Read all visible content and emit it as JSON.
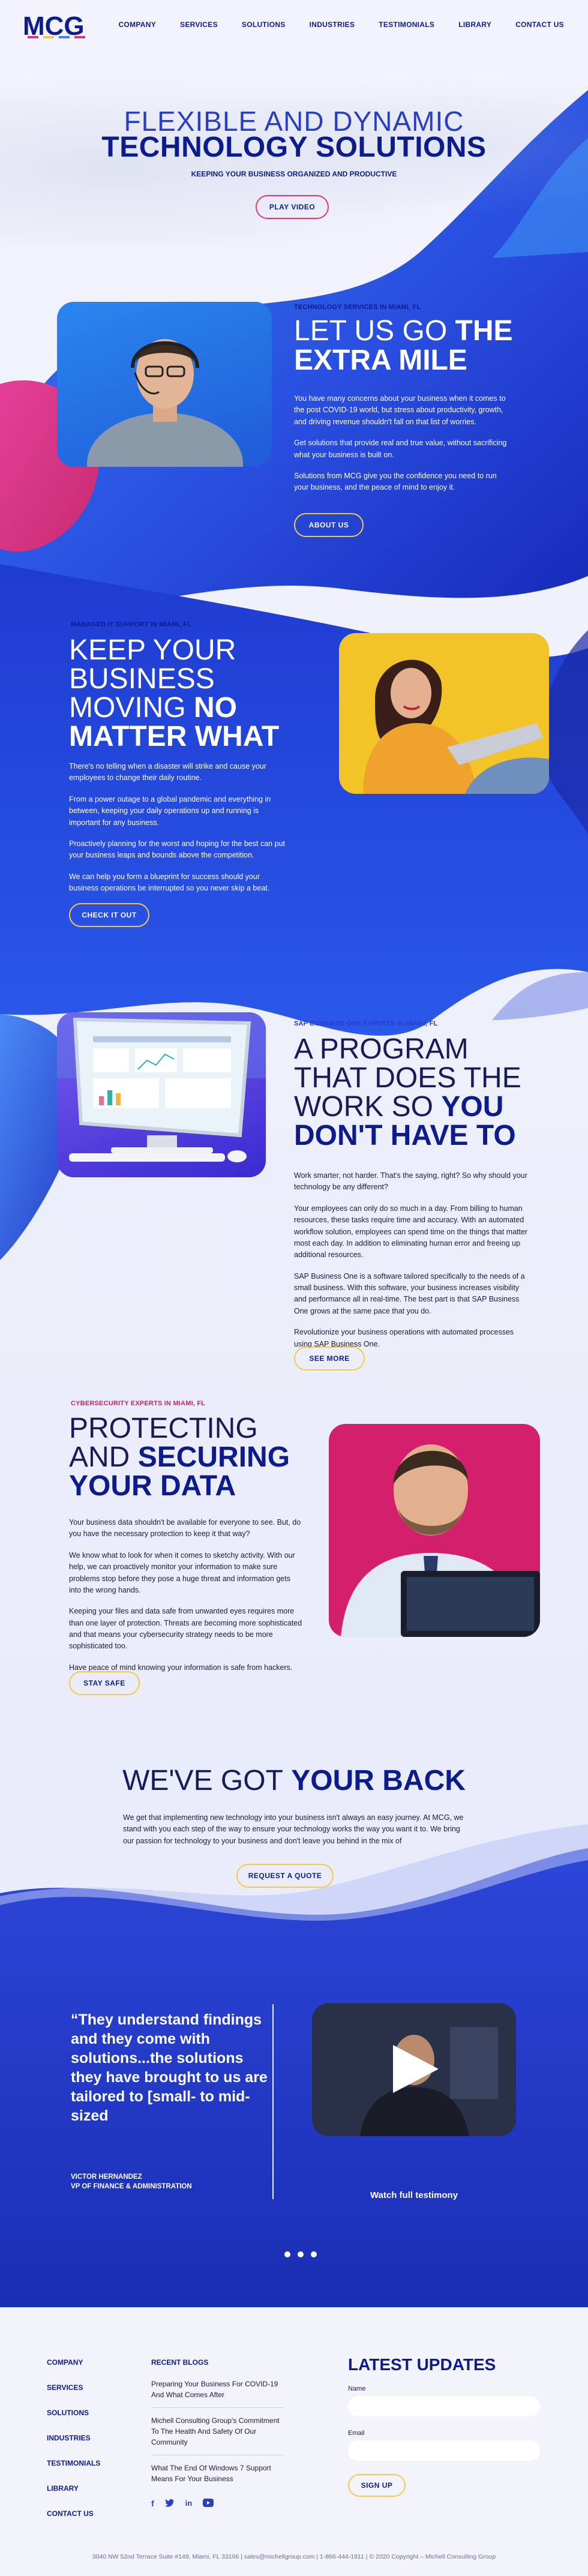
{
  "colors": {
    "navy": "#0d1c8c",
    "blue": "#2a3ec0",
    "pink": "#e0347c",
    "yellow": "#f5c94a",
    "background": "#eef0fb"
  },
  "brand": {
    "logo_text": "MCG"
  },
  "nav": {
    "items": [
      "COMPANY",
      "SERVICES",
      "SOLUTIONS",
      "INDUSTRIES",
      "TESTIMONIALS",
      "LIBRARY",
      "CONTACT US"
    ]
  },
  "hero": {
    "title_light": "FLEXIBLE AND DYNAMIC",
    "title_bold": "TECHNOLOGY SOLUTIONS",
    "subtitle": "KEEPING YOUR BUSINESS ORGANIZED AND PRODUCTIVE",
    "button": "PLAY VIDEO"
  },
  "section1": {
    "eyebrow": "TECHNOLOGY SERVICES IN MIAMI, FL",
    "heading_light": "LET US GO",
    "heading_bold_inline": "THE",
    "heading_bold": "EXTRA MILE",
    "paragraphs": [
      "You have many concerns about your business when it comes to the post COVID-19 world, but stress about productivity, growth, and driving revenue shouldn't fall on that list of worries.",
      "Get solutions that provide real and true value, without sacrificing what your business is built on.",
      "Solutions from MCG give you the confidence you need to run your business, and the peace of mind to enjoy it."
    ],
    "button": "ABOUT US"
  },
  "section2": {
    "eyebrow": "MANAGED IT SUPPORT IN MIAMI, FL",
    "heading_light_1": "KEEP YOUR",
    "heading_light_2": "BUSINESS",
    "heading_light_3": "MOVING",
    "heading_bold_inline": "NO",
    "heading_bold": "MATTER WHAT",
    "paragraphs": [
      "There's no telling when a disaster will strike and cause your employees to change their daily routine.",
      "From a power outage to a global pandemic and everything in between, keeping your daily operations up and running is important for any business.",
      "Proactively planning for the worst and hoping for the best can put your business leaps and bounds above the competition.",
      "We can help you form a blueprint for success should your business operations be interrupted so you never skip a beat."
    ],
    "button": "CHECK IT OUT"
  },
  "section3": {
    "eyebrow": "SAP BUSINESS ONE EXPERTS IN MIAMI, FL",
    "heading_light_1": "A PROGRAM",
    "heading_light_2": "THAT DOES THE",
    "heading_light_3": "WORK SO",
    "heading_bold_inline": "YOU",
    "heading_bold": "DON'T HAVE TO",
    "paragraphs": [
      "Work smarter, not harder. That's the saying, right? So why should your technology be any different?",
      "Your employees can only do so much in a day. From billing to human resources, these tasks require time and accuracy. With an automated workflow solution, employees can spend time on the things that matter most each day. In addition to eliminating human error and freeing up additional resources.",
      "SAP Business One is a software tailored specifically to the needs of a small business. With this software, your business increases visibility and performance all in real-time. The best part is that SAP Business One grows at the same pace that you do.",
      "Revolutionize your business operations with automated processes using SAP Business One."
    ],
    "button": "SEE MORE"
  },
  "section4": {
    "eyebrow": "CYBERSECURITY EXPERTS IN MIAMI, FL",
    "heading_light_1": "PROTECTING",
    "heading_light_2": "AND",
    "heading_bold_inline": "SECURING",
    "heading_bold": "YOUR DATA",
    "paragraphs": [
      "Your business data shouldn't be available for everyone to see. But, do you have the necessary protection to keep it that way?",
      "We know what to look for when it comes to sketchy activity. With our help, we can proactively monitor your information to make sure problems stop before they pose a huge threat and information gets into the wrong hands.",
      "Keeping your files and data safe from unwanted eyes requires more than one layer of protection. Threats are becoming more sophisticated and that means your cybersecurity strategy needs to be more sophisticated too.",
      "Have peace of mind knowing your information is safe from hackers."
    ],
    "button": "STAY SAFE"
  },
  "section5": {
    "heading_light": "WE'VE GOT",
    "heading_bold": "YOUR BACK",
    "paragraph": "We get that implementing new technology into your business isn't always an easy journey. At MCG, we stand with you each step of the way to ensure your technology works the way you want it to. We bring our passion for technology to your business and don't leave you behind in the mix of",
    "button": "REQUEST A QUOTE"
  },
  "testimonial": {
    "quote": "“They understand findings and they come with solutions...the solutions they have brought to us are tailored to [small- to mid-sized",
    "name": "VICTOR HERNANDEZ",
    "role": "VP OF FINANCE & ADMINISTRATION",
    "video_label": "Watch full testimony"
  },
  "footer": {
    "links": [
      "COMPANY",
      "SERVICES",
      "SOLUTIONS",
      "INDUSTRIES",
      "TESTIMONIALS",
      "LIBRARY",
      "CONTACT US"
    ],
    "blogs_title": "RECENT BLOGS",
    "blogs": [
      "Preparing Your Business For COVID-19 And What Comes After",
      "Michell Consulting Group's Commitment To The Health And Safety Of Our Community",
      "What The End Of Windows 7 Support Means For Your Business"
    ],
    "updates_title": "LATEST UPDATES",
    "name_label": "Name",
    "email_label": "Email",
    "signup_button": "SIGN UP",
    "bottom": "3040 NW 52nd Terrace Suite #149, Miami, FL 33166  |  sales@michellgroup.com  |  1-866-444-1911  |  © 2020 Copyright – Michell Consulting Group"
  }
}
